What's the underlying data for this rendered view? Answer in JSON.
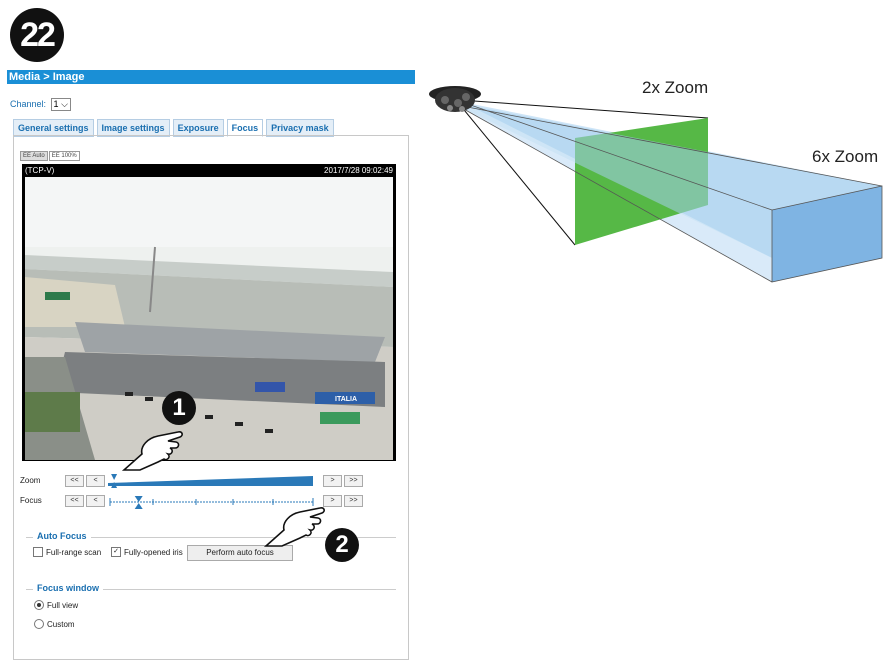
{
  "step_number": "22",
  "breadcrumb": "Media > Image",
  "channel": {
    "label": "Channel:",
    "value": "1"
  },
  "tabs": [
    {
      "label": "General settings"
    },
    {
      "label": "Image settings"
    },
    {
      "label": "Exposure"
    },
    {
      "label": "Focus",
      "active": true
    },
    {
      "label": "Privacy mask"
    }
  ],
  "aspect_buttons": [
    "EE Auto",
    "EE 100%"
  ],
  "viewer": {
    "camera_label": "(TCP-V)",
    "timestamp": "2017/7/28 09:02:49",
    "truck_text": "ITALIA"
  },
  "zoom": {
    "label": "Zoom",
    "buttons_left": [
      "<<",
      "<"
    ],
    "buttons_right": [
      ">",
      ">>"
    ],
    "level": 0.02
  },
  "focus": {
    "label": "Focus",
    "buttons_left": [
      "<<",
      "<"
    ],
    "buttons_right": [
      ">",
      ">>"
    ],
    "level": 0.14
  },
  "auto_focus": {
    "title": "Auto Focus",
    "full_range_scan": {
      "label": "Full-range scan",
      "checked": false
    },
    "fully_opened_iris": {
      "label": "Fully-opened iris",
      "checked": true
    },
    "perform_button": "Perform auto focus"
  },
  "focus_window": {
    "title": "Focus window",
    "options": [
      {
        "label": "Full view",
        "selected": true
      },
      {
        "label": "Custom",
        "selected": false
      }
    ]
  },
  "callouts": [
    "1",
    "2"
  ],
  "zoom_diagram": {
    "label_2x": "2x Zoom",
    "label_6x": "6x Zoom",
    "green": "#56b846",
    "blue": "#8ec4ea"
  }
}
